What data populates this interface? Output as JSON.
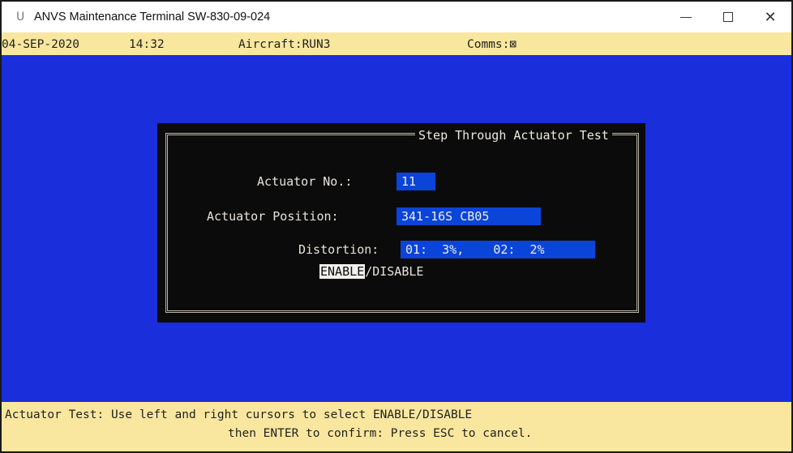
{
  "window": {
    "app_icon": "U",
    "title": "ANVS Maintenance Terminal SW-830-09-024",
    "controls": {
      "minimize": "",
      "maximize": "",
      "close": "✕"
    }
  },
  "status": {
    "date": "04-SEP-2020",
    "time": "14:32",
    "aircraft": "Aircraft:RUN3",
    "comms": "Comms:⊠"
  },
  "dialog": {
    "title": "Step Through Actuator Test",
    "actuator_no_label": "Actuator No.:",
    "actuator_no_value": "11",
    "actuator_position_label": "Actuator Position:",
    "actuator_position_value": "341-16S CB05",
    "distortion_label": "Distortion:",
    "distortion_value": "01:  3%,    02:  2%",
    "enable_label": "ENABLE",
    "separator": "/",
    "disable_label": "DISABLE",
    "selected": "ENABLE"
  },
  "help": {
    "line1": "Actuator Test: Use left and right cursors to select ENABLE/DISABLE",
    "line2": "then ENTER to confirm: Press ESC to cancel."
  },
  "colors": {
    "terminal_bg": "#1a2edb",
    "status_bg": "#f9e79f",
    "dialog_bg": "#0b0b0b",
    "value_bg": "#0a44d8"
  }
}
